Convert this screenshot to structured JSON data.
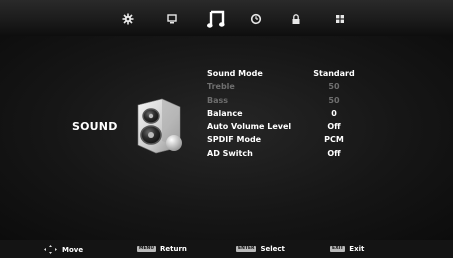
{
  "tabs": [
    {
      "icon": "picture-settings-icon",
      "active": false
    },
    {
      "icon": "channel-icon",
      "active": false
    },
    {
      "icon": "sound-icon",
      "active": true
    },
    {
      "icon": "time-icon",
      "active": false
    },
    {
      "icon": "lock-icon",
      "active": false
    },
    {
      "icon": "setup-icon",
      "active": false
    }
  ],
  "menu": {
    "title": "SOUND",
    "image": "speaker-icon",
    "items": [
      {
        "label": "Sound Mode",
        "value": "Standard",
        "enabled": true
      },
      {
        "label": "Treble",
        "value": "50",
        "enabled": false
      },
      {
        "label": "Bass",
        "value": "50",
        "enabled": false
      },
      {
        "label": "Balance",
        "value": "0",
        "enabled": true
      },
      {
        "label": "Auto Volume Level",
        "value": "Off",
        "enabled": true
      },
      {
        "label": "SPDIF Mode",
        "value": "PCM",
        "enabled": true
      },
      {
        "label": "AD Switch",
        "value": "Off",
        "enabled": true
      }
    ]
  },
  "footer": {
    "move": {
      "icon": "move-arrows-icon",
      "label": "Move"
    },
    "return": {
      "key": "MENU",
      "label": "Return"
    },
    "select": {
      "key": "ENTER",
      "label": "Select"
    },
    "exit": {
      "key": "EXIT",
      "label": "Exit"
    }
  }
}
